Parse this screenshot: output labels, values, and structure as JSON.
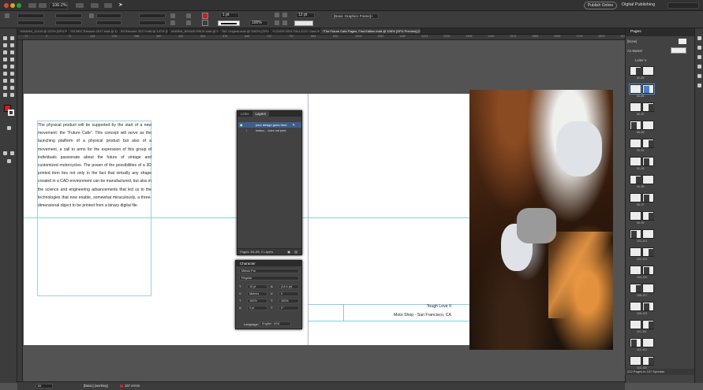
{
  "menubar": {
    "zoom_level": "106.2%",
    "publish_label": "Publish Online",
    "workspace_label": "Digital Publishing"
  },
  "control_bar": {
    "stroke_weight": "1 pt",
    "gap_value": "12 pt",
    "opacity_value": "100%",
    "object_style": "[Basic Graphics Frame]+"
  },
  "tabs": [
    {
      "label": "*MANNA_11444 @ 222% [GPU Preview]",
      "active": false
    },
    {
      "label": "*09 NEC Resume 2017.indd @ 125% [GPU Preview]",
      "active": false
    },
    {
      "label": "09 Resume 2017.indd @ 147% [GPU Preview]",
      "active": false
    },
    {
      "label": "MANNA_BRAND-PACK.indd @ 92% [GPU Preview]",
      "active": false
    },
    {
      "label": "*BC Original.indd @ 1182% [GPU Preview] [Convert]",
      "active": false
    },
    {
      "label": "*COVER 0901 FALL2021 Class Booklet.indd @ 87% [GPU Preview] [Convert]",
      "active": false
    },
    {
      "label": "*The Future Cafe Pages, First Edition.indd @ 106% [GPU Preview] [Convert]",
      "active": true
    }
  ],
  "ruler_marks": [
    "-72",
    "0",
    "72",
    "144",
    "216",
    "288",
    "360",
    "432",
    "504",
    "576",
    "648",
    "720",
    "792",
    "864",
    "936",
    "1008",
    "1080",
    "1152",
    "1224",
    "1296",
    "1368",
    "1440",
    "1512",
    "1584",
    "1656",
    "1728",
    "1800",
    "1872"
  ],
  "document": {
    "body_text": "The physical product will be supported by the start of a new movement: the \"Future Cafe\". This concept will serve as the launching platform of a physical product but also of a movement, a call to arms for the expression of this group of individuals passionate about the future of vintage and customized motorcycles. The power of the possibilities of a 3D printed item lies not only in the fact that virtually any shape created in a CAD environment can be manufactured, but also in the science and engineering advancements that led us to the technologies that now enable, somewhat miraculously, a three-dimensional object to be printed from a binary digital file.",
    "caption_line1": "Tough Love II",
    "caption_line2": "Moto Shop - San Francisco, CA"
  },
  "layers_panel": {
    "tab_links": "Links",
    "tab_layers": "Layers",
    "layer1": "your design goes here",
    "layer2": "instruc... does not print",
    "footer": "Pages: 84–85, 2 Layers"
  },
  "character_panel": {
    "title": "Character",
    "font_family": "Minion Pro",
    "font_style": "Regular",
    "font_size": "12 pt",
    "leading": "(14.4 pt)",
    "kerning": "Metrics",
    "tracking": "0",
    "vertical_scale": "100%",
    "horizontal_scale": "100%",
    "baseline_shift": "0 pt",
    "skew": "0°",
    "language_label": "Language:",
    "language_value": "English: USA"
  },
  "pages_panel": {
    "title": "Pages",
    "none_label": "[None]",
    "master_label": "A1-Master",
    "section_label": "Leiter V",
    "spreads": [
      "82–83",
      "84–85",
      "86–87",
      "88–89",
      "90–91",
      "92–93",
      "94–95",
      "96–97",
      "98–99",
      "100–101",
      "102–103",
      "104–105",
      "106–107",
      "108–109",
      "110–111",
      "112–113",
      "114–115"
    ],
    "footer": "212 Pages in 107 Spreads"
  },
  "statusbar": {
    "page": "84",
    "preflight": "[Basic] (working)",
    "errors": "167 errors"
  },
  "colors": {
    "fill": "#c42026",
    "guide_cyan": "#46c3d3",
    "guide_violet": "#9b8bd6",
    "layer_highlight": "#3d5f8a"
  }
}
